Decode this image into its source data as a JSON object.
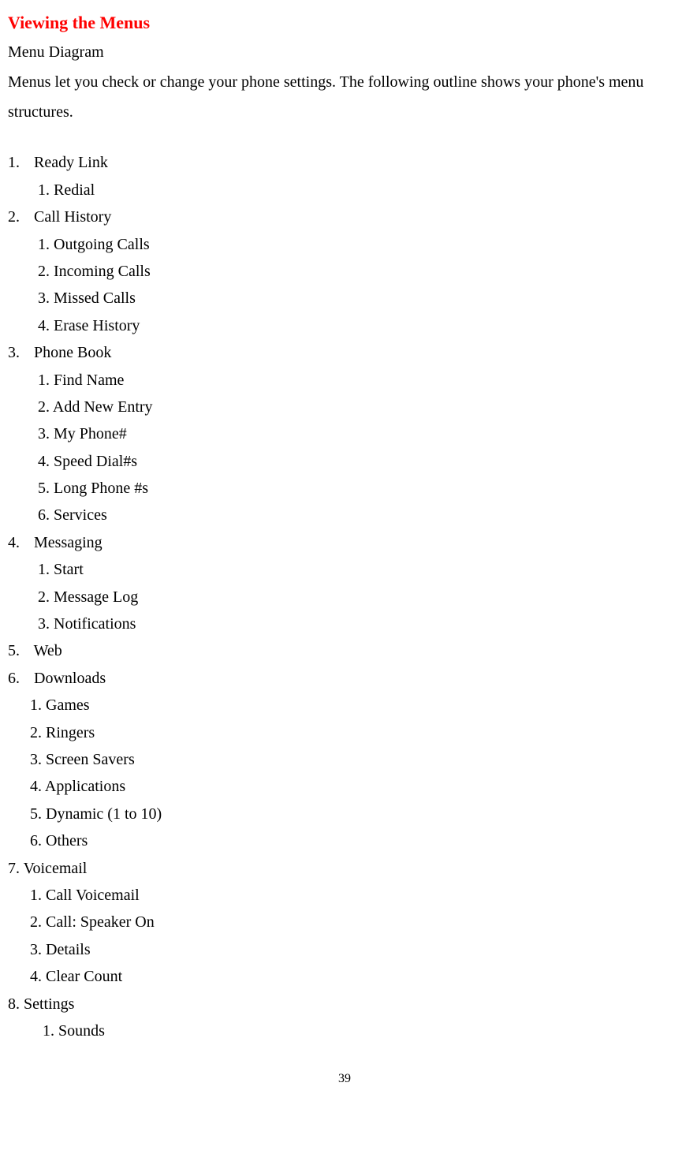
{
  "heading": "Viewing the Menus",
  "subheading": "Menu Diagram",
  "intro": "Menus let you check or change your phone settings. The following outline shows your phone's menu structures.",
  "menu": {
    "items": [
      {
        "num": "1.",
        "label": "Ready Link",
        "subs": [
          "1. Redial"
        ],
        "style": "a"
      },
      {
        "num": "2.",
        "label": "Call History",
        "subs": [
          "1. Outgoing Calls",
          "2. Incoming Calls",
          "3. Missed Calls",
          "4. Erase History"
        ],
        "style": "a"
      },
      {
        "num": "3.",
        "label": "Phone Book",
        "subs": [
          "1. Find Name",
          "2. Add New Entry",
          "3. My Phone#",
          "4. Speed Dial#s",
          "5. Long Phone #s",
          "6. Services"
        ],
        "style": "a"
      },
      {
        "num": "4.",
        "label": "Messaging",
        "subs": [
          "1. Start",
          "2. Message Log",
          "3. Notifications"
        ],
        "style": "a"
      },
      {
        "num": "5.",
        "label": "Web",
        "subs": [],
        "style": "a"
      },
      {
        "num": "6.",
        "label": " Downloads",
        "subs": [
          "1. Games",
          "2. Ringers",
          "3. Screen Savers",
          "4. Applications",
          "5. Dynamic (1 to 10)",
          "6. Others"
        ],
        "style": "b"
      },
      {
        "num": "7.",
        "label": "Voicemail",
        "subs": [
          "1. Call Voicemail",
          "2. Call: Speaker On",
          "3. Details",
          "4. Clear Count"
        ],
        "style": "c"
      },
      {
        "num": "8.",
        "label": "Settings",
        "subs": [
          "1. Sounds"
        ],
        "style": "c2"
      }
    ]
  },
  "pageNumber": "39"
}
